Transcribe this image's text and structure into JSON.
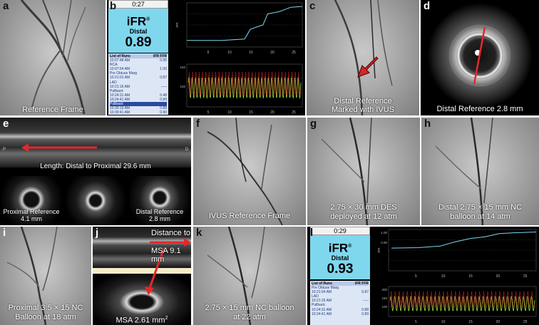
{
  "panels": {
    "a": {
      "label": "a",
      "caption": "Reference Frame"
    },
    "b": {
      "label": "b",
      "time": "0:27",
      "ifr_title": "iFR",
      "ifr_sup": "®",
      "ifr_sub": "Distal",
      "ifr_value": "0.89",
      "runs_title": "List of Runs",
      "runs_headers": [
        "iFR",
        "FFR"
      ],
      "runs": [
        {
          "t": "10:07:48 AM",
          "v": "0.95",
          "hl": false
        },
        {
          "t": "RCA",
          "v": "",
          "hl": false
        },
        {
          "t": "10:07:54 AM",
          "v": "1.00",
          "hl": false
        },
        {
          "t": "Pre Obtuse Marg",
          "v": "",
          "hl": false
        },
        {
          "t": "10:21:01 AM",
          "v": "0.87",
          "hl": false
        },
        {
          "t": "LAD",
          "v": "",
          "hl": false
        },
        {
          "t": "10:21:16 AM",
          "v": "-----",
          "hl": false
        },
        {
          "t": "Pullback",
          "v": "",
          "hl": false
        },
        {
          "t": "10:24:31 AM",
          "v": "0.48",
          "hl": false
        },
        {
          "t": "10:24:41 AM",
          "v": "0.89",
          "hl": false
        },
        {
          "t": "Pullback",
          "v": "",
          "hl": true
        },
        {
          "t": "10:30:19 AM",
          "v": "0.88",
          "hl": false
        },
        {
          "t": "10:30:41 AM",
          "v": "0.90",
          "hl": false
        },
        {
          "t": "Diagonal",
          "v": "",
          "hl": false
        }
      ],
      "top_x_ticks": [
        "5",
        "10",
        "15",
        "20",
        "25"
      ],
      "top_y_label": "iFR",
      "bot_x_ticks": [
        "5",
        "10",
        "15",
        "20",
        "25"
      ],
      "bot_y_ticks": [
        "150",
        "100"
      ]
    },
    "c": {
      "label": "c",
      "caption1": "Distal Reference",
      "caption2": "Marked with IVUS"
    },
    "d": {
      "label": "d",
      "caption": "Distal Reference 2.8 mm"
    },
    "e": {
      "label": "e",
      "caption": "Length: Distal to Proximal 29.6 mm",
      "left_mark": "P",
      "right_mark": "D",
      "sub1_line1": "Proximal Reference",
      "sub1_line2": "4.1 mm",
      "sub3_line1": "Distal Reference",
      "sub3_line2": "2.8 mm"
    },
    "f": {
      "label": "f",
      "caption": "IVUS Reference Frame"
    },
    "g": {
      "label": "g",
      "caption1": "2.75 × 30 mm DES",
      "caption2": "deployed at 12 atm"
    },
    "h": {
      "label": "h",
      "caption1": "Distal 2.75 × 15 mm NC",
      "caption2": "balloon at 14 atm"
    },
    "i": {
      "label": "i",
      "caption1": "Proximal 3.5 × 15 NC",
      "caption2": "Balloon at 18 atm"
    },
    "j": {
      "label": "j",
      "dist1": "Distance to",
      "dist2": "MSA 9.1 mm",
      "msa": "MSA 2.61 mm",
      "msa_sup": "2"
    },
    "k": {
      "label": "k",
      "caption1": "2.75 × 15 mm NC balloon",
      "caption2": "at 22 atm"
    },
    "l": {
      "label": "l",
      "time": "0:29",
      "ifr_title": "iFR",
      "ifr_sup": "®",
      "ifr_sub": "Distal",
      "ifr_value": "0.93",
      "runs_title": "List of Runs",
      "runs_headers": [
        "iFR",
        "FFR"
      ],
      "runs": [
        {
          "t": "Pre Obtuse Marg",
          "v": "",
          "hl": false
        },
        {
          "t": "10:21:04 AM",
          "v": "0.87",
          "hl": false
        },
        {
          "t": "LAD",
          "v": "",
          "hl": false
        },
        {
          "t": "10:21:16 AM",
          "v": "-----",
          "hl": false
        },
        {
          "t": "Pullback",
          "v": "",
          "hl": false
        },
        {
          "t": "10:24:31 AM",
          "v": "0.88",
          "hl": false
        },
        {
          "t": "10:24:41 AM",
          "v": "0.89",
          "hl": false
        }
      ],
      "top_x_ticks": [
        "5",
        "10",
        "15",
        "20",
        "25"
      ],
      "top_y_ticks": [
        "1.00",
        "0.90"
      ],
      "top_y_label": "iFR",
      "bot_x_ticks": [
        "5",
        "10",
        "15",
        "20",
        "25"
      ],
      "bot_y_ticks": [
        "200",
        "150",
        "100"
      ]
    }
  },
  "colors": {
    "ifr_box": "#7fd7ee",
    "pressure_red": "#e8262a",
    "pressure_green": "#9be23a",
    "trend": "#7fd7ee",
    "arrow": "#d8262a"
  }
}
